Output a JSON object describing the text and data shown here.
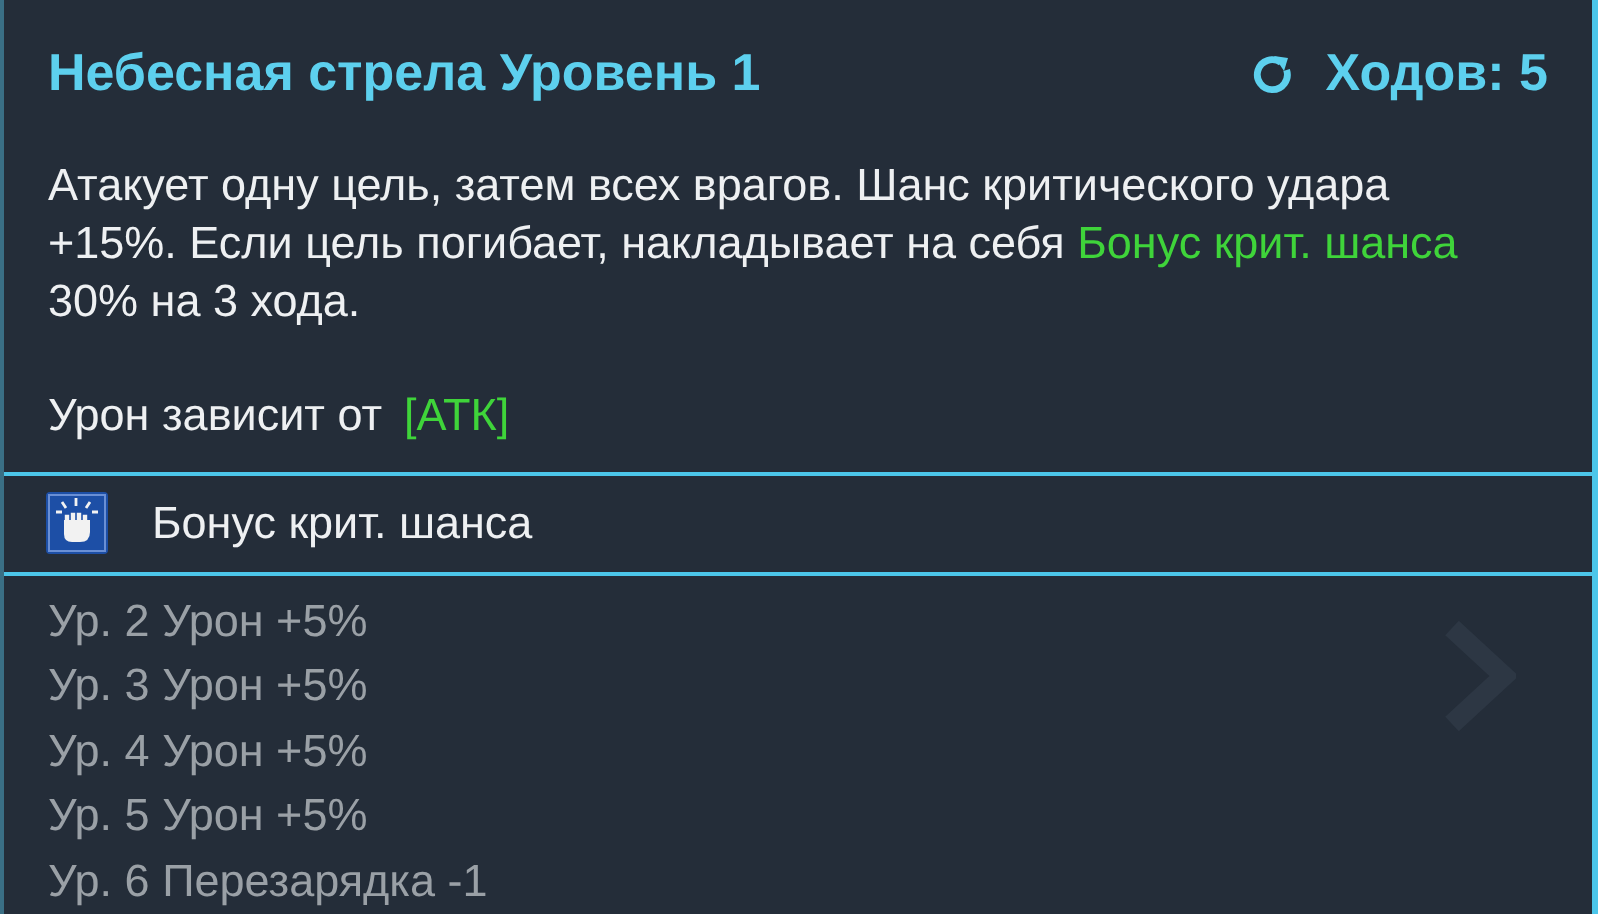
{
  "skill": {
    "title": "Небесная стрела Уровень 1",
    "turns": "Ходов: 5"
  },
  "description": [
    {
      "text": "Атакует одну цель, затем всех врагов. Шанс критического удара +15%. Если цель погибает, накладывает на себя ",
      "highlight": false
    },
    {
      "text": "Бонус крит. шанса",
      "highlight": true
    },
    {
      "text": " 30% на 3 хода.",
      "highlight": false
    }
  ],
  "damage": {
    "label": "Урон зависит от",
    "stat": "[АТК]"
  },
  "buff": {
    "name": "Бонус крит. шанса"
  },
  "upgrades": [
    "Ур. 2 Урон +5%",
    "Ур. 3 Урон +5%",
    "Ур. 4 Урон +5%",
    "Ур. 5 Урон +5%",
    "Ур. 6 Перезарядка -1"
  ]
}
